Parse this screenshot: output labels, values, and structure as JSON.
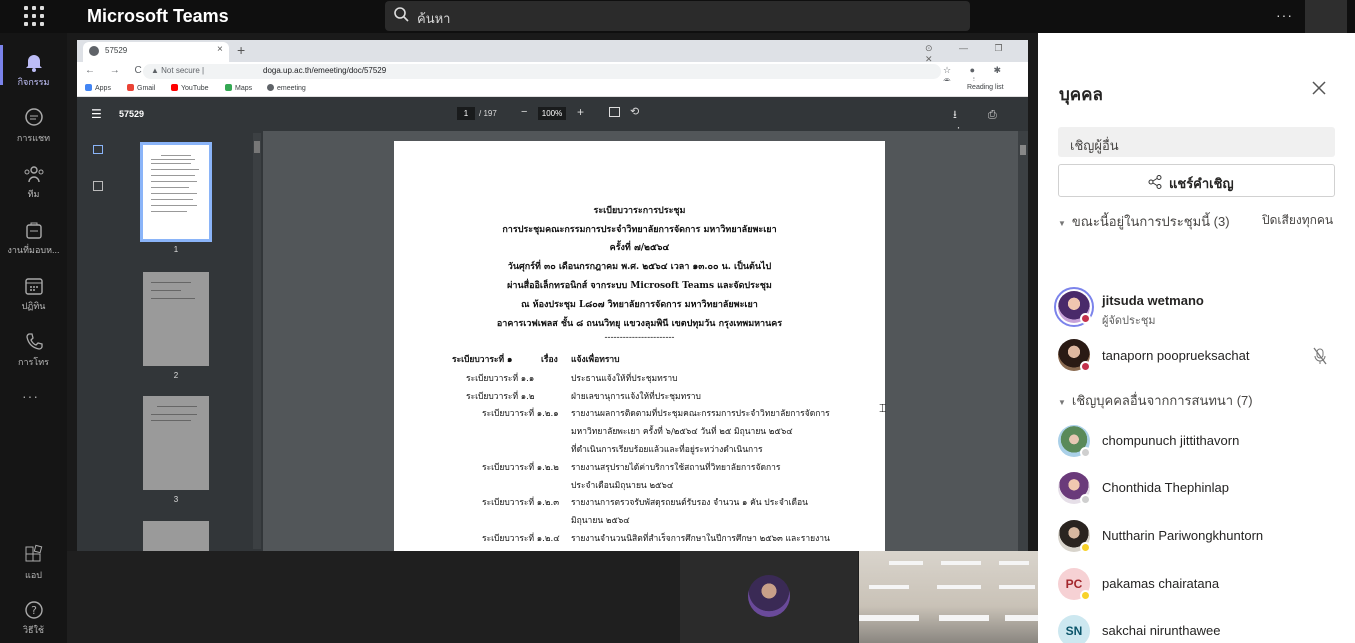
{
  "app": {
    "title": "Microsoft Teams",
    "search_placeholder": "ค้นหา",
    "more": "···"
  },
  "rail": {
    "items": [
      {
        "label": "กิจกรรม",
        "icon": "bell-icon"
      },
      {
        "label": "การแชท",
        "icon": "chat-icon"
      },
      {
        "label": "ทีม",
        "icon": "teams-icon"
      },
      {
        "label": "งานที่มอบห...",
        "icon": "assignments-icon"
      },
      {
        "label": "ปฏิทิน",
        "icon": "calendar-icon"
      },
      {
        "label": "การโทร",
        "icon": "phone-icon"
      }
    ],
    "more": "···",
    "bottom": [
      {
        "label": "แอป",
        "icon": "apps-icon"
      },
      {
        "label": "วิธีใช้",
        "icon": "help-icon"
      }
    ]
  },
  "browser": {
    "tab_title": "57529",
    "tab_close": "×",
    "new_tab": "+",
    "window_controls": "⊙ — ❐ ✕",
    "nav": "← → C",
    "security": "▲ Not secure |",
    "url": "doga.up.ac.th/emeeting/doc/57529",
    "bookmarks": [
      "Apps",
      "Gmail",
      "YouTube",
      "Maps",
      "emeeting"
    ],
    "reading_list": "Reading list"
  },
  "pdf": {
    "name": "57529",
    "page_current": "1",
    "page_total": "/ 197",
    "zoom": "100%",
    "thumb_numbers": [
      "1",
      "2",
      "3"
    ],
    "header_lines": [
      "ระเบียบวาระการประชุม",
      "การประชุมคณะกรรมการประจำวิทยาลัยการจัดการ มหาวิทยาลัยพะเยา",
      "ครั้งที่ ๗/๒๕๖๔",
      "วันศุกร์ที่ ๓๐ เดือนกรกฎาคม พ.ศ. ๒๕๖๔ เวลา ๑๓.๐๐ น. เป็นต้นไป",
      "ผ่านสื่ออิเล็กทรอนิกส์ จากระบบ Microsoft Teams และจัดประชุม",
      "ณ ห้องประชุม L๘๐๗ วิทยาลัยการจัดการ มหาวิทยาลัยพะเยา",
      "อาคารเวฟเพลส ชั้น ๘ ถนนวิทยุ แขวงลุมพินี เขตปทุมวัน กรุงเทพมหานคร",
      "-----------------------"
    ],
    "agenda_head": {
      "label": "ระเบียบวาระที่ ๑",
      "word": "เรื่อง",
      "title": "แจ้งเพื่อทราบ"
    },
    "rows": [
      {
        "label": "ระเบียบวาระที่ ๑.๑",
        "text": "ประธานแจ้งให้ที่ประชุมทราบ"
      },
      {
        "label": "ระเบียบวาระที่ ๑.๒",
        "text": "ฝ่ายเลขานุการแจ้งให้ที่ประชุมทราบ"
      },
      {
        "label": "ระเบียบวาระที่ ๑.๒.๑",
        "text": "รายงานผลการติดตามที่ประชุมคณะกรรมการประจำวิทยาลัยการจัดการ"
      },
      {
        "label": "",
        "text": "มหาวิทยาลัยพะเยา ครั้งที่ ๖/๒๕๖๔ วันที่ ๒๕ มิถุนายน ๒๕๖๔"
      },
      {
        "label": "",
        "text": "ที่ดำเนินการเรียบร้อยแล้วและที่อยู่ระหว่างดำเนินการ"
      },
      {
        "label": "ระเบียบวาระที่ ๑.๒.๒",
        "text": "รายงานสรุปรายได้ค่าบริการใช้สถานที่วิทยาลัยการจัดการ"
      },
      {
        "label": "",
        "text": "ประจำเดือนมิถุนายน ๒๕๖๔"
      },
      {
        "label": "ระเบียบวาระที่ ๑.๒.๓",
        "text": "รายงานการตรวจรับพัสดุรถยนต์รับรอง จำนวน ๑ คัน ประจำเดือน"
      },
      {
        "label": "",
        "text": "มิถุนายน ๒๕๖๔"
      },
      {
        "label": "ระเบียบวาระที่ ๑.๒.๔",
        "text": "รายงานจำนวนนิสิตที่สำเร็จการศึกษาในปีการศึกษา ๒๕๖๓ และรายงาน"
      }
    ]
  },
  "people": {
    "title": "บุคคล",
    "invite_placeholder": "เชิญผู้อื่น",
    "share_invite": "แชร์คำเชิญ",
    "in_meeting_header": "ขณะนี้อยู่ในการประชุมนี้ (3)",
    "mute_all": "ปิดเสียงทุกคน",
    "in_meeting": [
      {
        "name": "jitsuda wetmano",
        "role": "ผู้จัดประชุม"
      },
      {
        "name": "tanaporn pooprueksachat",
        "role": ""
      }
    ],
    "invite_header": "เชิญบุคคลอื่นจากการสนทนา (7)",
    "others": [
      {
        "name": "chompunuch jittithavorn",
        "initials": ""
      },
      {
        "name": "Chonthida Thephinlap",
        "initials": ""
      },
      {
        "name": "Nuttharin Pariwongkhuntorn",
        "initials": ""
      },
      {
        "name": "pakamas chairatana",
        "initials": "PC"
      },
      {
        "name": "sakchai nirunthawee",
        "initials": "SN"
      }
    ],
    "colors": {
      "busy": "#c4314b",
      "away": "#f8d22a",
      "offline": "#cfcfcf"
    }
  }
}
